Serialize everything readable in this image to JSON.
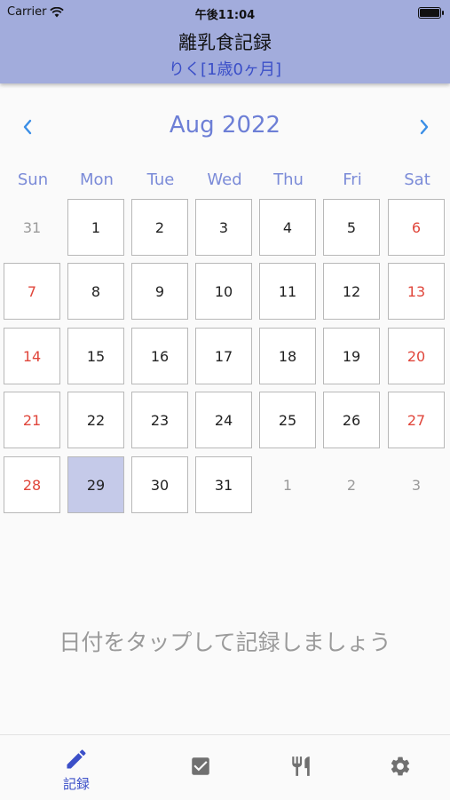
{
  "status_bar": {
    "carrier": "Carrier",
    "time": "午後11:04"
  },
  "header": {
    "title": "離乳食記録",
    "subtitle": "りく[1歳0ヶ月]"
  },
  "calendar": {
    "month_label": "Aug 2022",
    "weekdays": [
      "Sun",
      "Mon",
      "Tue",
      "Wed",
      "Thu",
      "Fri",
      "Sat"
    ],
    "weeks": [
      [
        {
          "d": "31",
          "other": true
        },
        {
          "d": "1"
        },
        {
          "d": "2"
        },
        {
          "d": "3"
        },
        {
          "d": "4"
        },
        {
          "d": "5"
        },
        {
          "d": "6"
        }
      ],
      [
        {
          "d": "7"
        },
        {
          "d": "8"
        },
        {
          "d": "9"
        },
        {
          "d": "10"
        },
        {
          "d": "11"
        },
        {
          "d": "12"
        },
        {
          "d": "13"
        }
      ],
      [
        {
          "d": "14"
        },
        {
          "d": "15"
        },
        {
          "d": "16"
        },
        {
          "d": "17"
        },
        {
          "d": "18"
        },
        {
          "d": "19"
        },
        {
          "d": "20"
        }
      ],
      [
        {
          "d": "21"
        },
        {
          "d": "22"
        },
        {
          "d": "23"
        },
        {
          "d": "24"
        },
        {
          "d": "25"
        },
        {
          "d": "26"
        },
        {
          "d": "27"
        }
      ],
      [
        {
          "d": "28"
        },
        {
          "d": "29",
          "selected": true
        },
        {
          "d": "30"
        },
        {
          "d": "31"
        },
        {
          "d": "1",
          "other": true
        },
        {
          "d": "2",
          "other": true
        },
        {
          "d": "3",
          "other": true
        }
      ]
    ]
  },
  "hint": "日付をタップして記録しましょう",
  "tabbar": {
    "tabs": [
      {
        "label": "記録",
        "icon": "pencil-icon",
        "active": true
      },
      {
        "label": "",
        "icon": "checkbox-icon",
        "active": false
      },
      {
        "label": "",
        "icon": "fork-knife-icon",
        "active": false
      },
      {
        "label": "",
        "icon": "gear-icon",
        "active": false
      }
    ]
  },
  "colors": {
    "header_bg": "#a2acdc",
    "accent": "#3b4fc8",
    "weekend": "#e0463b",
    "selected_bg": "#c5cae9",
    "muted": "#9a9a9a"
  }
}
